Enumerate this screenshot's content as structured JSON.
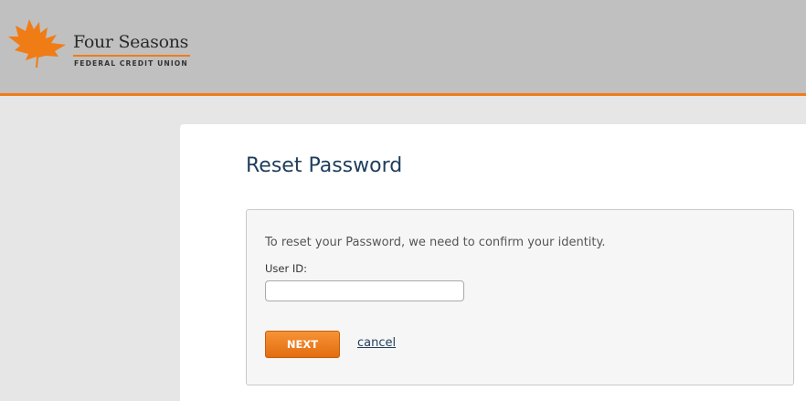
{
  "header": {
    "brand_name": "Four Seasons",
    "brand_subtitle": "FEDERAL CREDIT UNION",
    "logo_icon": "maple-leaf-icon"
  },
  "colors": {
    "accent": "#f07c16",
    "header_bg": "#c0c0c0",
    "title": "#1f3d5c",
    "page_bg": "#e6e6e6"
  },
  "main": {
    "title": "Reset Password",
    "intro": "To reset your Password, we need to confirm your identity.",
    "user_id": {
      "label": "User ID:",
      "value": "",
      "placeholder": ""
    },
    "next_label": "NEXT",
    "cancel_label": "cancel"
  }
}
